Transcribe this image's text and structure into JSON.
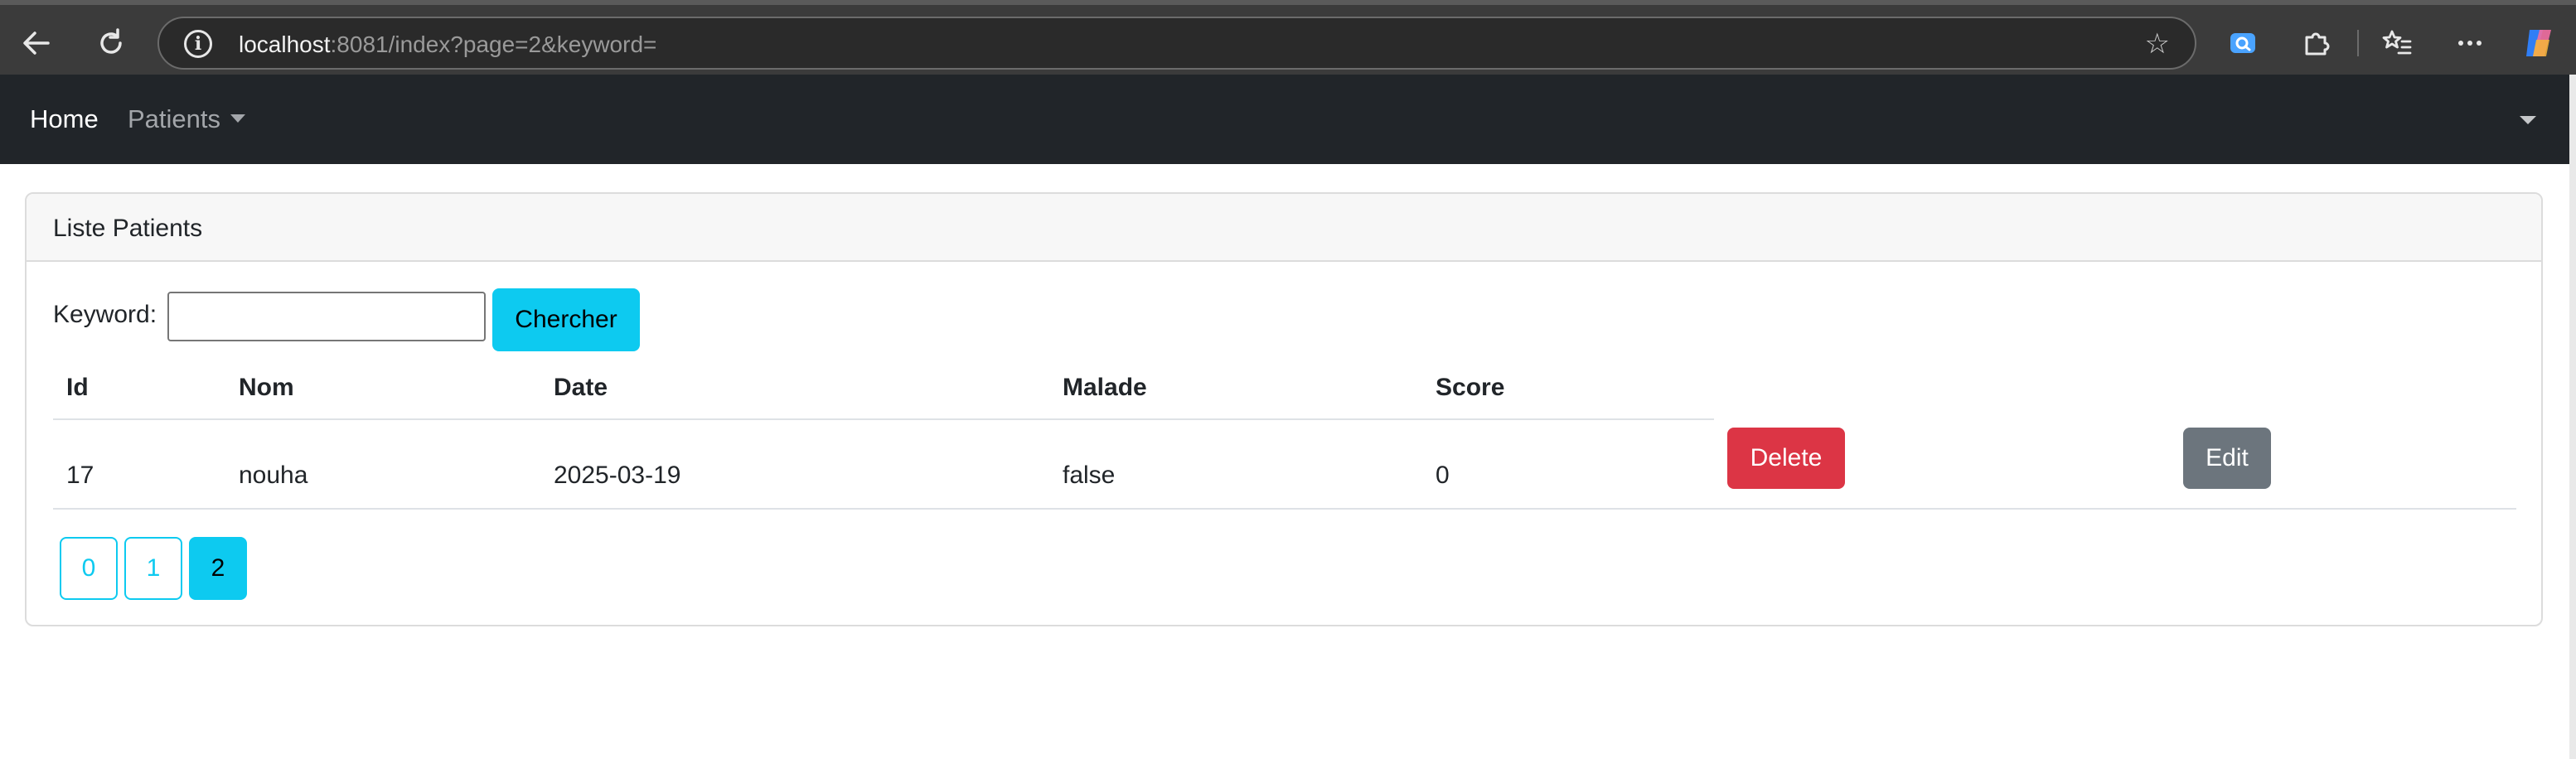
{
  "browser": {
    "url_host": "localhost",
    "url_rest": ":8081/index?page=2&keyword="
  },
  "navbar": {
    "home_label": "Home",
    "patients_label": "Patients"
  },
  "card": {
    "title": "Liste Patients"
  },
  "search": {
    "label": "Keyword:",
    "value": "",
    "button_label": "Chercher"
  },
  "table": {
    "headers": [
      "Id",
      "Nom",
      "Date",
      "Malade",
      "Score"
    ],
    "rows": [
      {
        "id": "17",
        "nom": "nouha",
        "date": "2025-03-19",
        "malade": "false",
        "score": "0",
        "delete_label": "Delete",
        "edit_label": "Edit"
      }
    ]
  },
  "pagination": {
    "pages": [
      "0",
      "1",
      "2"
    ],
    "current": "2"
  },
  "colors": {
    "navbar_bg": "#212529",
    "info": "#0dcaf0",
    "danger": "#dc3545",
    "secondary": "#6c757d"
  }
}
